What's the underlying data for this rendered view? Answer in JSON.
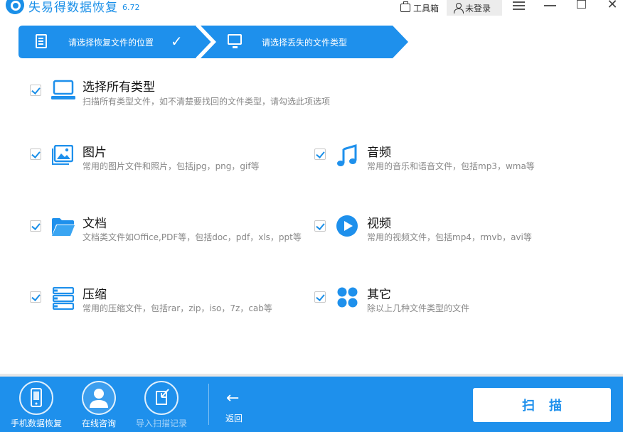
{
  "app": {
    "title": "失易得数据恢复",
    "version": "6.72"
  },
  "titlebar": {
    "toolbox_label": "工具箱",
    "login_label": "未登录"
  },
  "steps": [
    {
      "label": "请选择恢复文件的位置",
      "icon": "document-icon",
      "done": true
    },
    {
      "label": "请选择丢失的文件类型",
      "icon": "monitor-icon",
      "done": false
    }
  ],
  "options": {
    "all": {
      "title": "选择所有类型",
      "desc": "扫描所有类型文件，如不清楚要找回的文件类型，请勾选此项选项",
      "checked": true,
      "icon": "laptop-icon"
    },
    "images": {
      "title": "图片",
      "desc": "常用的图片文件和照片，包括jpg，png，gif等",
      "checked": true,
      "icon": "image-icon"
    },
    "audio": {
      "title": "音频",
      "desc": "常用的音乐和语音文件，包括mp3，wma等",
      "checked": true,
      "icon": "music-note-icon"
    },
    "docs": {
      "title": "文档",
      "desc": "文档类文件如Office,PDF等，包括doc，pdf，xls，ppt等",
      "checked": true,
      "icon": "folder-icon"
    },
    "video": {
      "title": "视频",
      "desc": "常用的视频文件，包括mp4，rmvb，avi等",
      "checked": true,
      "icon": "play-icon"
    },
    "archive": {
      "title": "压缩",
      "desc": "常用的压缩文件，包括rar，zip，iso，7z，cab等",
      "checked": true,
      "icon": "archive-icon"
    },
    "other": {
      "title": "其它",
      "desc": "除以上几种文件类型的文件",
      "checked": true,
      "icon": "grid-dots-icon"
    }
  },
  "bottom": {
    "phone_recovery": "手机数据恢复",
    "online_help": "在线咨询",
    "import_scan": "导入扫描记录",
    "back": "返回",
    "scan": "扫描"
  },
  "colors": {
    "accent": "#1e90ec",
    "text_muted": "#888888"
  }
}
